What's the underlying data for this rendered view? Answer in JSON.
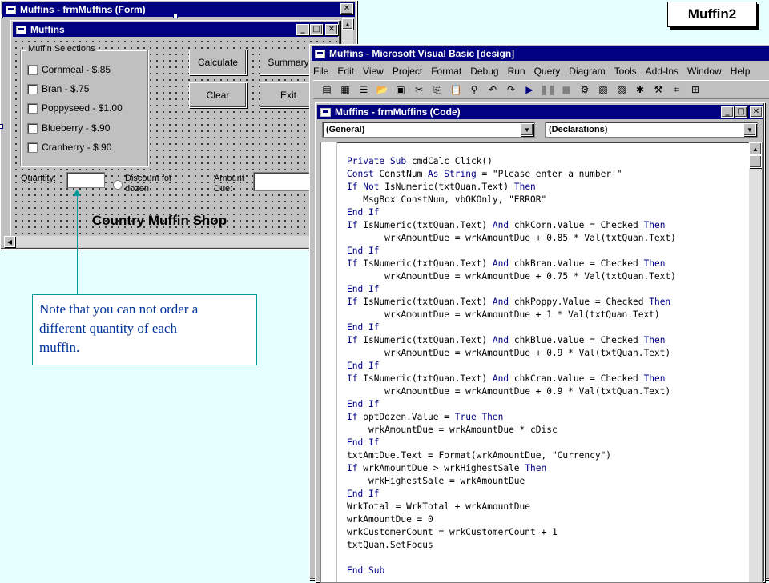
{
  "badge": "Muffin2",
  "form_designer": {
    "title": "Muffins - frmMuffins (Form)",
    "inner_title": "Muffins",
    "frame_label": "Muffin Selections",
    "checkboxes": [
      {
        "label": "Cornmeal - $.85"
      },
      {
        "label": "Bran - $.75"
      },
      {
        "label": "Poppyseed - $1.00"
      },
      {
        "label": "Blueberry - $.90"
      },
      {
        "label": "Cranberry - $.90"
      }
    ],
    "buttons": {
      "calculate": "Calculate",
      "summary": "Summary",
      "clear": "Clear",
      "exit": "Exit"
    },
    "quantity_label": "Quantity:",
    "discount_label_1": "Discount for",
    "discount_label_2": "dozen",
    "amount_label_1": "Amount",
    "amount_label_2": "Due:",
    "shop_name": "Country Muffin Shop"
  },
  "note": {
    "line1": "Note that you can not order a",
    "line2": "different quantity of each",
    "line3": "muffin."
  },
  "ide": {
    "title": "Muffins - Microsoft Visual Basic [design]",
    "menu": [
      "File",
      "Edit",
      "View",
      "Project",
      "Format",
      "Debug",
      "Run",
      "Query",
      "Diagram",
      "Tools",
      "Add-Ins",
      "Window",
      "Help"
    ],
    "code_window": {
      "title": "Muffins - frmMuffins (Code)",
      "object_combo": "(General)",
      "proc_combo": "(Declarations)",
      "lines": [
        "Private Sub cmdCalc_Click()",
        "Const ConstNum As String = \"Please enter a number!\"",
        "If Not IsNumeric(txtQuan.Text) Then",
        "   MsgBox ConstNum, vbOKOnly, \"ERROR\"",
        "End If",
        "If IsNumeric(txtQuan.Text) And chkCorn.Value = Checked Then",
        "       wrkAmountDue = wrkAmountDue + 0.85 * Val(txtQuan.Text)",
        "End If",
        "If IsNumeric(txtQuan.Text) And chkBran.Value = Checked Then",
        "       wrkAmountDue = wrkAmountDue + 0.75 * Val(txtQuan.Text)",
        "End If",
        "If IsNumeric(txtQuan.Text) And chkPoppy.Value = Checked Then",
        "       wrkAmountDue = wrkAmountDue + 1 * Val(txtQuan.Text)",
        "End If",
        "If IsNumeric(txtQuan.Text) And chkBlue.Value = Checked Then",
        "       wrkAmountDue = wrkAmountDue + 0.9 * Val(txtQuan.Text)",
        "End If",
        "If IsNumeric(txtQuan.Text) And chkCran.Value = Checked Then",
        "       wrkAmountDue = wrkAmountDue + 0.9 * Val(txtQuan.Text)",
        "End If",
        "If optDozen.Value = True Then",
        "    wrkAmountDue = wrkAmountDue * cDisc",
        "End If",
        "txtAmtDue.Text = Format(wrkAmountDue, \"Currency\")",
        "If wrkAmountDue > wrkHighestSale Then",
        "    wrkHighestSale = wrkAmountDue",
        "End If",
        "WrkTotal = WrkTotal + wrkAmountDue",
        "wrkAmountDue = 0",
        "wrkCustomerCount = wrkCustomerCount + 1",
        "txtQuan.SetFocus",
        "",
        "End Sub"
      ]
    }
  }
}
